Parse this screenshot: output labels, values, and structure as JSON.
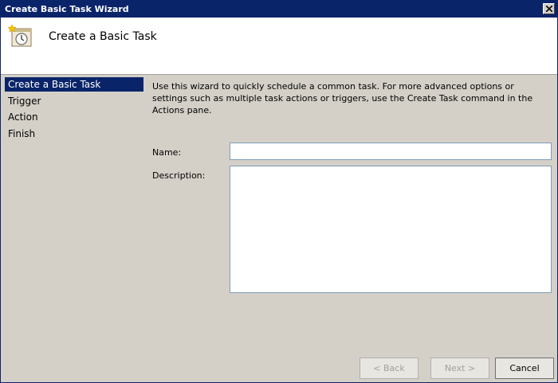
{
  "window": {
    "title": "Create Basic Task Wizard"
  },
  "header": {
    "icon": "task-scheduler-icon",
    "title": "Create a Basic Task"
  },
  "steps": [
    {
      "label": "Create a Basic Task",
      "active": true
    },
    {
      "label": "Trigger",
      "active": false
    },
    {
      "label": "Action",
      "active": false
    },
    {
      "label": "Finish",
      "active": false
    }
  ],
  "main": {
    "intro": "Use this wizard to quickly schedule a common task.  For more advanced options or settings such as multiple task actions or triggers, use the Create Task command in the Actions pane.",
    "name_label": "Name:",
    "name_value": "",
    "description_label": "Description:",
    "description_value": ""
  },
  "buttons": {
    "back": "< Back",
    "next": "Next >",
    "cancel": "Cancel"
  },
  "colors": {
    "title_bar": "#0a246a",
    "selected_step": "#0a246a",
    "background": "#d4d0c8"
  }
}
